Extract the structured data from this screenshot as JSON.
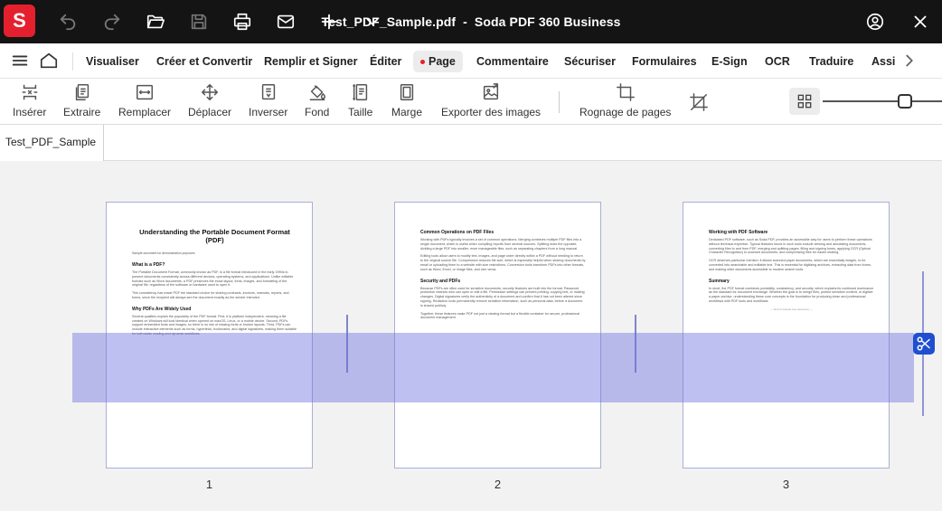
{
  "window": {
    "title_file": "Test_PDF_Sample.pdf",
    "title_sep": "-",
    "title_app": "Soda PDF 360 Business",
    "logo_letter": "S",
    "accent": "#e5202e"
  },
  "menu": {
    "items": [
      "Visualiser",
      "Créer et Convertir",
      "Remplir et Signer",
      "Éditer",
      "Page",
      "Commentaire",
      "Sécuriser",
      "Formulaires",
      "E-Sign",
      "OCR",
      "Traduire",
      "Assis"
    ]
  },
  "toolbar": {
    "tools": [
      "Insérer",
      "Extraire",
      "Remplacer",
      "Déplacer",
      "Inverser",
      "Fond",
      "Taille",
      "Marge",
      "Exporter des images",
      "Rognage de pages"
    ]
  },
  "doc_tab": "Test_PDF_Sample",
  "pages": [
    {
      "number": "1",
      "title": "Understanding the Portable Document Format (PDF)",
      "subtitle": "Sample document for demonstration purposes",
      "h_a": "What is a PDF?",
      "p_a1": "The Portable Document Format, commonly known as PDF, is a file format introduced in the early 1990s to present documents consistently across different devices, operating systems, and applications. Unlike editable formats such as Word documents, a PDF preserves the exact layout, fonts, images, and formatting of the original file, regardless of the software or hardware used to open it.",
      "p_a2": "This consistency has made PDF the standard choice for sharing contracts, invoices, manuals, reports, and forms, since the recipient will always see the document exactly as the sender intended.",
      "h_b": "Why PDFs Are Widely Used",
      "p_b1": "Several qualities explain the popularity of the PDF format. First, it is platform independent, meaning a file created on Windows will look identical when opened on macOS, Linux, or a mobile device. Second, PDFs support embedded fonts and images, so there is no risk of missing fonts or broken layouts. Third, PDFs can include interactive elements such as forms, hyperlinks, bookmarks, and digital signatures, making them suitable for both static reading and dynamic workflows."
    },
    {
      "number": "2",
      "h_a": "Common Operations on PDF Files",
      "p_a1": "Working with PDFs typically involves a set of common operations. Merging combines multiple PDF files into a single document, which is useful when compiling reports from several sources. Splitting does the opposite, dividing a large PDF into smaller, more manageable files, such as separating chapters from a long manual.",
      "p_a2": "Editing tools allow users to modify text, images, and page order directly within a PDF without needing to return to the original source file. Compression reduces file size, which is especially helpful when sharing documents by email or uploading them to a website with size restrictions. Conversion tools transform PDFs into other formats, such as Word, Excel, or image files, and vice versa.",
      "h_b": "Security and PDFs",
      "p_b1": "Because PDFs are often used for sensitive documents, security features are built into the format. Password protection restricts who can open or edit a file. Permission settings can prevent printing, copying text, or making changes. Digital signatures verify the authenticity of a document and confirm that it has not been altered since signing. Redaction tools permanently remove sensitive information, such as personal data, before a document is shared publicly.",
      "p_b2": "Together, these features make PDF not just a viewing format but a flexible container for secure, professional document management."
    },
    {
      "number": "3",
      "h_a": "Working with PDF Software",
      "p_a1": "Dedicated PDF software, such as Soda PDF, provides an accessible way for users to perform these operations without technical expertise. Typical features found in such tools include viewing and annotating documents, converting files to and from PDF, merging and splitting pages, filling and signing forms, applying OCR (Optical Character Recognition) to scanned documents, and compressing files for easier sharing.",
      "p_a2": "OCR deserves particular mention: it allows scanned paper documents, which are essentially images, to be converted into searchable and editable text. This is essential for digitizing archives, extracting data from forms, and making older documents accessible to modern search tools.",
      "h_b": "Summary",
      "p_b1": "In short, the PDF format combines portability, consistency, and security, which explains its continued dominance as the standard for document exchange. Whether the goal is to merge files, protect sensitive content, or digitize a paper archive, understanding these core concepts is the foundation for producing clean and professional workflows with PDF tools and workflows.",
      "footer": "— End of sample test document —"
    }
  ]
}
